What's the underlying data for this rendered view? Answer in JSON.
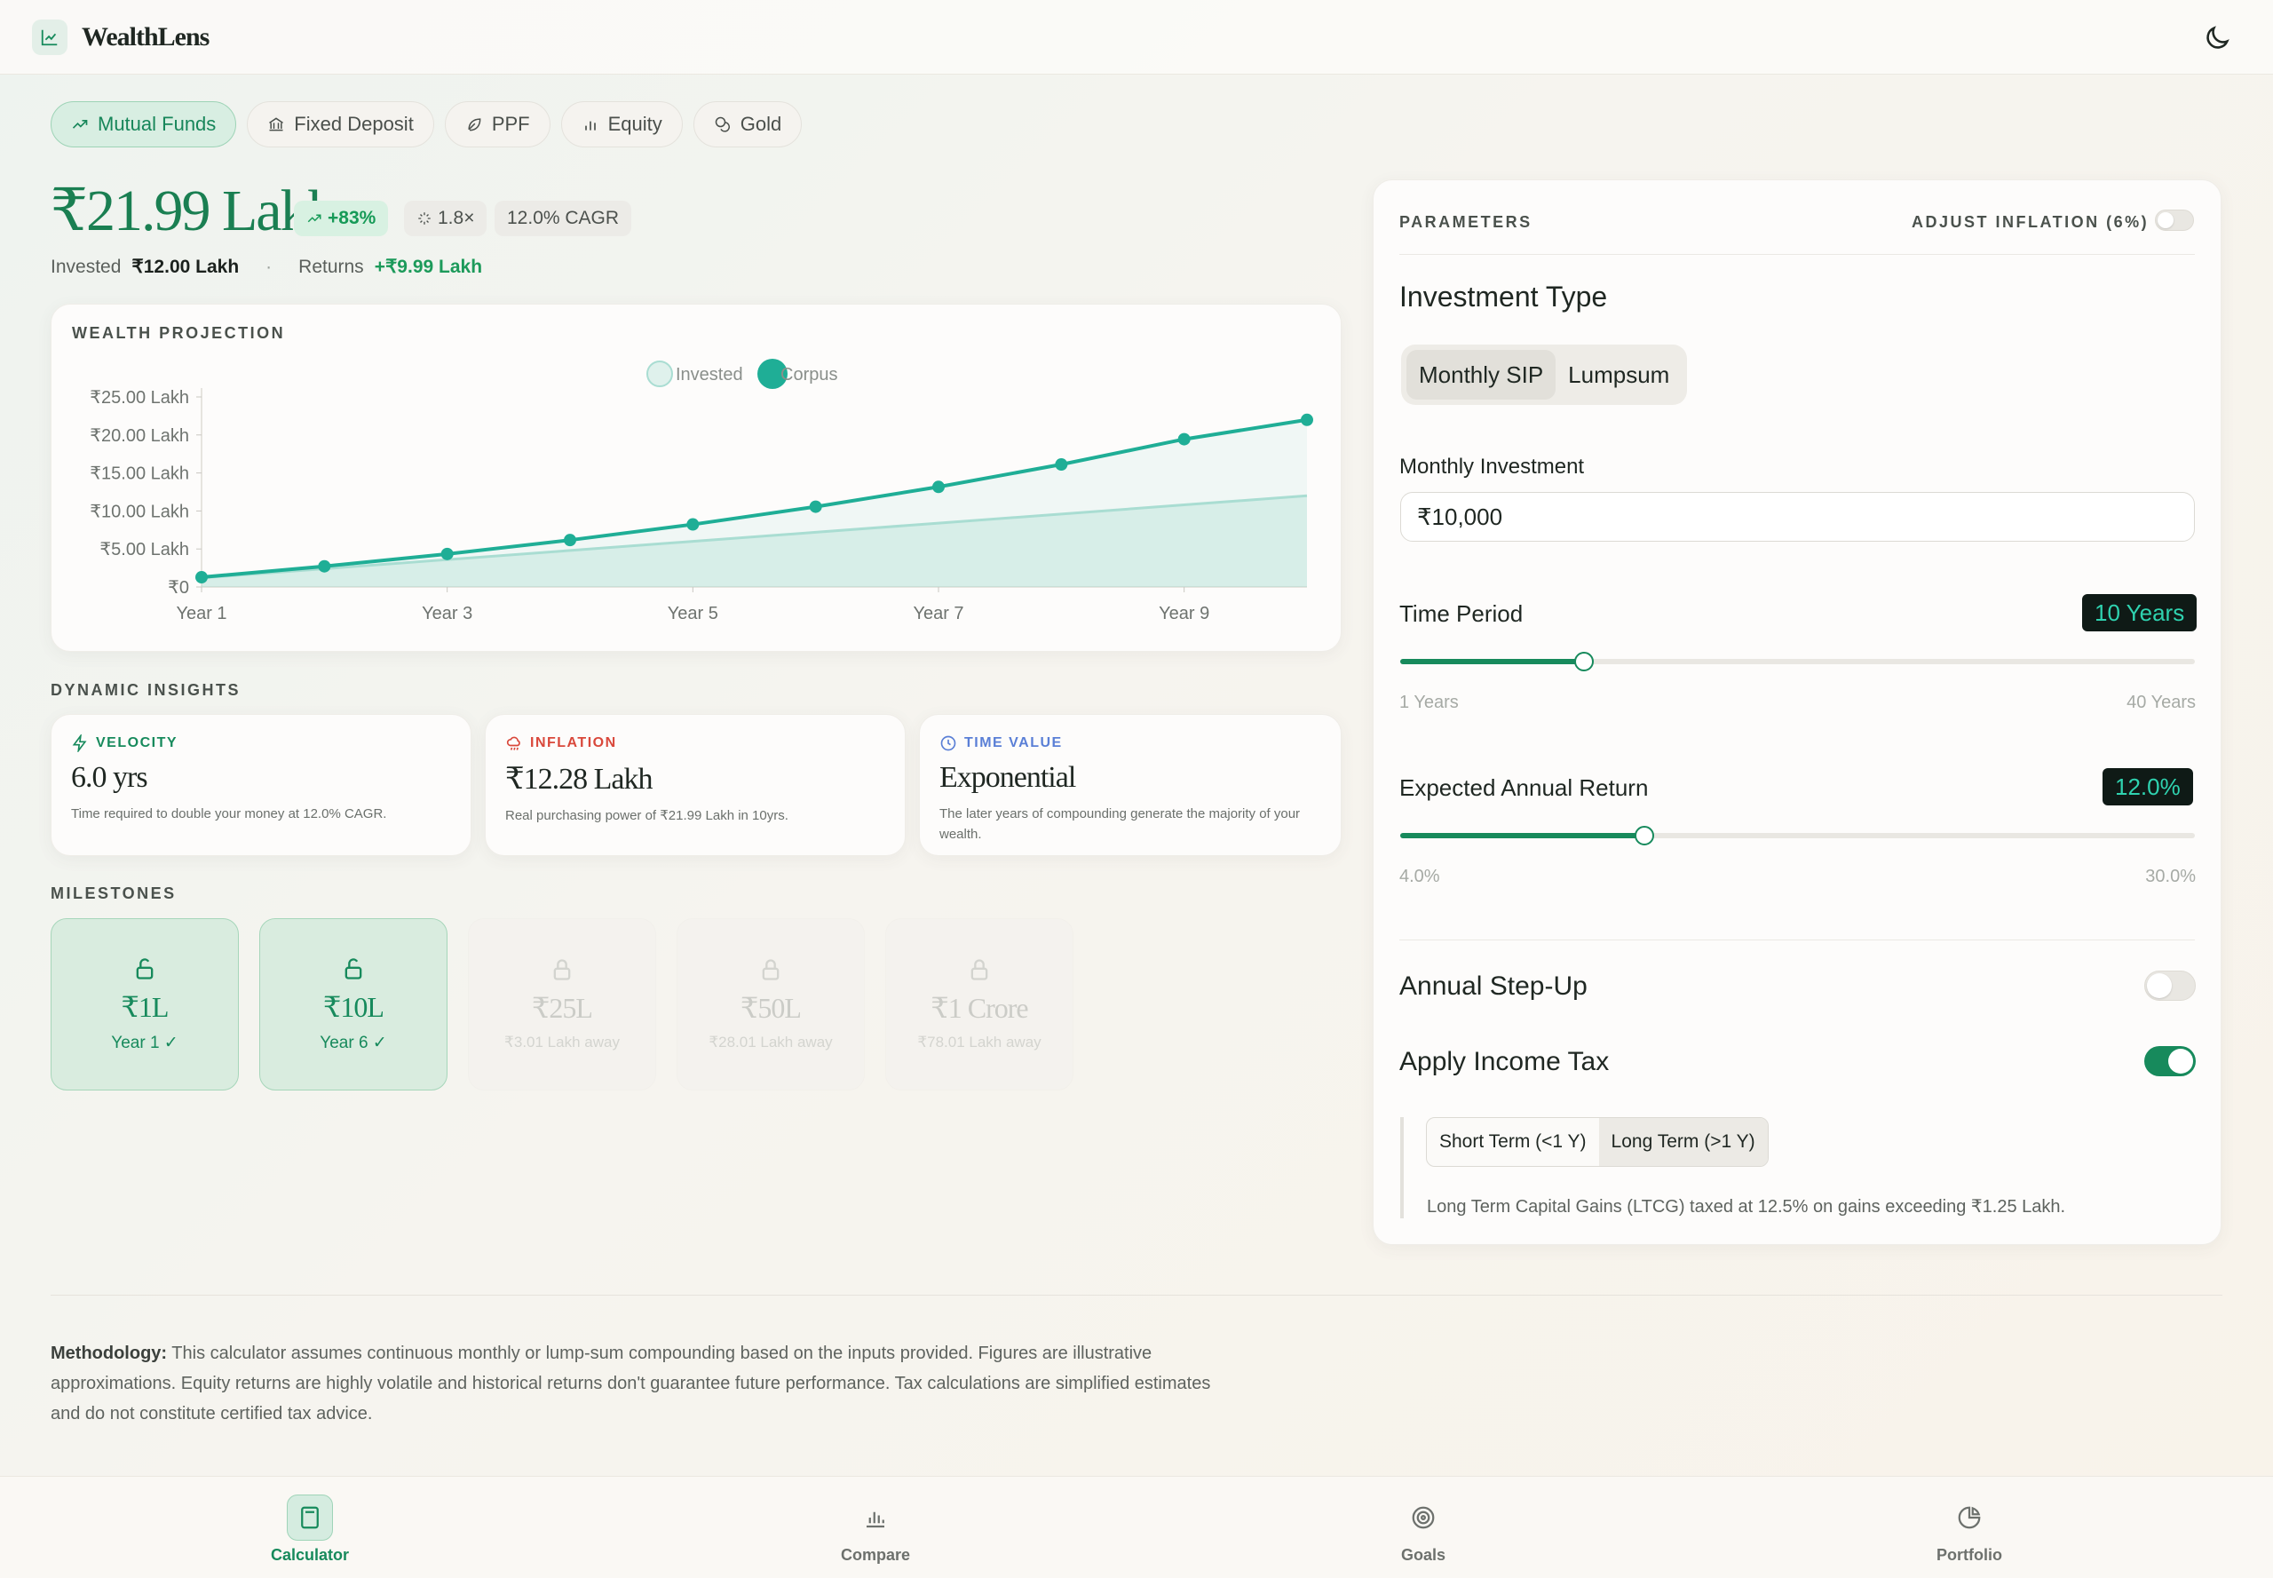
{
  "app": {
    "name": "WealthLens"
  },
  "tabs": [
    {
      "label": "Mutual Funds",
      "icon": "trending-up-icon",
      "active": true
    },
    {
      "label": "Fixed Deposit",
      "icon": "bank-icon",
      "active": false
    },
    {
      "label": "PPF",
      "icon": "leaf-icon",
      "active": false
    },
    {
      "label": "Equity",
      "icon": "bar-chart-icon",
      "active": false
    },
    {
      "label": "Gold",
      "icon": "coins-icon",
      "active": false
    }
  ],
  "summary": {
    "corpus": "₹21.99 Lakh",
    "gain_pct": "+83%",
    "multiplier": "1.8×",
    "cagr": "12.0% CAGR",
    "invested_label": "Invested",
    "invested_value": "₹12.00 Lakh",
    "separator": "·",
    "returns_label": "Returns",
    "returns_value": "+₹9.99 Lakh"
  },
  "projection": {
    "title": "WEALTH PROJECTION"
  },
  "chart_data": {
    "type": "line",
    "x": [
      "Year 1",
      "Year 2",
      "Year 3",
      "Year 4",
      "Year 5",
      "Year 6",
      "Year 7",
      "Year 8",
      "Year 9",
      "Year 10"
    ],
    "xticks": [
      "Year 1",
      "Year 3",
      "Year 5",
      "Year 7",
      "Year 9"
    ],
    "yticks": [
      "₹0",
      "₹5.00 Lakh",
      "₹10.00 Lakh",
      "₹15.00 Lakh",
      "₹20.00 Lakh",
      "₹25.00 Lakh"
    ],
    "ylim": [
      0,
      25
    ],
    "legend_position": "top-center",
    "series": [
      {
        "name": "Invested",
        "color": "#a9ddd2",
        "values": [
          1.2,
          2.4,
          3.6,
          4.8,
          6.0,
          7.2,
          8.4,
          9.6,
          10.8,
          12.0
        ]
      },
      {
        "name": "Corpus",
        "color": "#1fae96",
        "values": [
          1.28,
          2.72,
          4.34,
          6.17,
          8.23,
          10.56,
          13.17,
          16.12,
          19.44,
          21.99
        ]
      }
    ]
  },
  "insights": {
    "title": "DYNAMIC INSIGHTS",
    "items": [
      {
        "label": "VELOCITY",
        "value": "6.0 yrs",
        "desc": "Time required to double your money at 12.0% CAGR.",
        "color": "#178a5c",
        "icon": "lightning-icon"
      },
      {
        "label": "INFLATION",
        "value": "₹12.28 Lakh",
        "desc": "Real purchasing power of ₹21.99 Lakh in 10yrs.",
        "color": "#d9483b",
        "icon": "cloud-rain-icon"
      },
      {
        "label": "TIME VALUE",
        "value": "Exponential",
        "desc": "The later years of compounding generate the majority of your wealth.",
        "color": "#5a7fd6",
        "icon": "clock-icon"
      }
    ]
  },
  "milestones": {
    "title": "MILESTONES",
    "items": [
      {
        "value": "₹1L",
        "sub": "Year 1 ✓",
        "reached": true
      },
      {
        "value": "₹10L",
        "sub": "Year 6 ✓",
        "reached": true
      },
      {
        "value": "₹25L",
        "sub": "₹3.01 Lakh away",
        "reached": false
      },
      {
        "value": "₹50L",
        "sub": "₹28.01 Lakh away",
        "reached": false
      },
      {
        "value": "₹1 Crore",
        "sub": "₹78.01 Lakh away",
        "reached": false
      }
    ]
  },
  "params": {
    "title": "PARAMETERS",
    "inflation_label": "ADJUST INFLATION (6%)",
    "inflation_on": false,
    "investment_type_label": "Investment Type",
    "type_options": [
      "Monthly SIP",
      "Lumpsum"
    ],
    "type_selected": "Monthly SIP",
    "monthly_label": "Monthly Investment",
    "monthly_value": "₹10,000",
    "period_label": "Time Period",
    "period_value": "10 Years",
    "period_level": 0.2308,
    "period_min": "1 Years",
    "period_max": "40 Years",
    "return_label": "Expected Annual Return",
    "return_value": "12.0%",
    "return_level": 0.3077,
    "return_min": "4.0%",
    "return_max": "30.0%",
    "stepup_label": "Annual Step-Up",
    "stepup_on": false,
    "tax_label": "Apply Income Tax",
    "tax_on": true,
    "tax_options": [
      "Short Term (<1 Y)",
      "Long Term (>1 Y)"
    ],
    "tax_selected": "Long Term (>1 Y)",
    "tax_note": "Long Term Capital Gains (LTCG) taxed at 12.5% on gains exceeding ₹1.25 Lakh."
  },
  "methodology": {
    "lead": "Methodology:",
    "text": " This calculator assumes continuous monthly or lump-sum compounding based on the inputs provided. Figures are illustrative approximations. Equity returns are highly volatile and historical returns don't guarantee future performance. Tax calculations are simplified estimates and do not constitute certified tax advice."
  },
  "nav": [
    {
      "label": "Calculator",
      "icon": "calculator-icon",
      "active": true
    },
    {
      "label": "Compare",
      "icon": "bar-chart-icon",
      "active": false
    },
    {
      "label": "Goals",
      "icon": "target-icon",
      "active": false
    },
    {
      "label": "Portfolio",
      "icon": "pie-chart-icon",
      "active": false
    }
  ],
  "colors": {
    "accent": "#178a5c",
    "teal": "#1fae96",
    "danger": "#d9483b",
    "info": "#5a7fd6"
  }
}
